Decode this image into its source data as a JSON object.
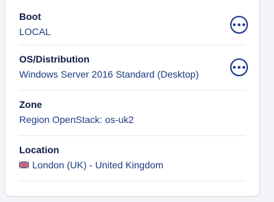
{
  "boot": {
    "label": "Boot",
    "value": "LOCAL",
    "actions_icon": "ellipsis-circle-icon"
  },
  "os": {
    "label": "OS/Distribution",
    "value": "Windows Server 2016 Standard (Desktop)",
    "actions_icon": "ellipsis-circle-icon"
  },
  "zone": {
    "label": "Zone",
    "value": "Region OpenStack: os-uk2"
  },
  "location": {
    "label": "Location",
    "flag_icon": "uk-flag-icon",
    "value": "London (UK) - United Kingdom"
  },
  "colors": {
    "label": "#0f1b49",
    "value": "#1b3d82",
    "accent": "#1f3a8f",
    "divider": "#e6e9ef"
  }
}
